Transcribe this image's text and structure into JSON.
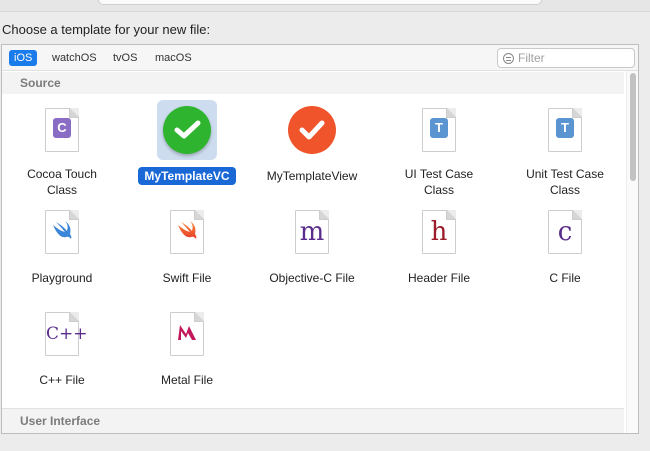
{
  "window": {
    "prompt": "Choose a template for your new file:"
  },
  "platform_tabs": [
    "iOS",
    "watchOS",
    "tvOS",
    "macOS"
  ],
  "selected_tab": "iOS",
  "filter": {
    "placeholder": "Filter",
    "value": ""
  },
  "sections": {
    "source": "Source",
    "user_interface": "User Interface"
  },
  "templates": [
    {
      "label": "Cocoa Touch Class",
      "label_lines": [
        "Cocoa Touch",
        "Class"
      ],
      "icon": "cocoa-touch-class-icon",
      "selected": false
    },
    {
      "label": "MyTemplateVC",
      "label_lines": [
        "MyTemplateVC"
      ],
      "icon": "green-checkmark-icon",
      "selected": true
    },
    {
      "label": "MyTemplateView",
      "label_lines": [
        "MyTemplateView"
      ],
      "icon": "orange-checkmark-icon",
      "selected": false
    },
    {
      "label": "UI Test Case Class",
      "label_lines": [
        "UI Test Case",
        "Class"
      ],
      "icon": "ui-test-case-icon",
      "selected": false
    },
    {
      "label": "Unit Test Case Class",
      "label_lines": [
        "Unit Test Case",
        "Class"
      ],
      "icon": "unit-test-case-icon",
      "selected": false
    },
    {
      "label": "Playground",
      "label_lines": [
        "Playground"
      ],
      "icon": "playground-swift-icon",
      "selected": false
    },
    {
      "label": "Swift File",
      "label_lines": [
        "Swift File"
      ],
      "icon": "swift-file-icon",
      "selected": false
    },
    {
      "label": "Objective-C File",
      "label_lines": [
        "Objective-C File"
      ],
      "icon": "objc-file-icon",
      "selected": false
    },
    {
      "label": "Header File",
      "label_lines": [
        "Header File"
      ],
      "icon": "header-file-icon",
      "selected": false
    },
    {
      "label": "C File",
      "label_lines": [
        "C File"
      ],
      "icon": "c-file-icon",
      "selected": false
    },
    {
      "label": "C++ File",
      "label_lines": [
        "C++ File"
      ],
      "icon": "cpp-file-icon",
      "selected": false
    },
    {
      "label": "Metal File",
      "label_lines": [
        "Metal File"
      ],
      "icon": "metal-file-icon",
      "selected": false
    }
  ],
  "icon_glyphs": {
    "cocoa": "C",
    "test": "T",
    "objc": "m",
    "header": "h",
    "c": "c",
    "cpp": "C++"
  },
  "colors": {
    "accent": "#1a7bea",
    "selection_bg": "#cddcee",
    "green": "#2fb430",
    "orange": "#f0542a"
  }
}
